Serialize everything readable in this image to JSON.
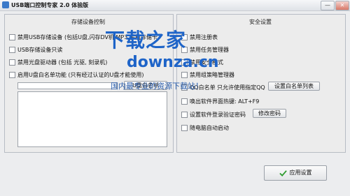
{
  "window": {
    "title": "USB端口控制专家 2.0 体验版"
  },
  "storage_panel": {
    "title": "存储设备控制",
    "options": [
      {
        "label": "禁用USB存储设备 (包括U盘,闪存DV机,MP3,手机存储卡"
      },
      {
        "label": "USB存储设备只读"
      },
      {
        "label": "禁用光盘驱动器 (包括 光驱, 刻录机)"
      },
      {
        "label": "启用U盘白名单功能 (只有经过认证的U盘才能使用)"
      }
    ],
    "whitelist_button": "U盘白名单"
  },
  "security_panel": {
    "title": "安全设置",
    "options": [
      {
        "label": "禁用注册表"
      },
      {
        "label": "禁用任务管理器"
      },
      {
        "label": "禁用安全模式"
      },
      {
        "label": "禁用组策略管理器"
      },
      {
        "label": "QQ白名单 只允许使用指定QQ"
      },
      {
        "label": "唤出软件界面热键: ALT+F9"
      },
      {
        "label": "设置软件登录验证密码"
      },
      {
        "label": "随电脑自动启动"
      }
    ],
    "qq_whitelist_button": "设置白名单列表",
    "change_password_button": "修改密码"
  },
  "apply_button": "应用设置",
  "watermark": {
    "line1": "下载之家",
    "line2": "downza.cn",
    "line3": "国内最专业的资源下载站！"
  },
  "colors": {
    "watermark_blue": "#1E64C8",
    "accent_green": "#2E9B2E"
  },
  "icons": {
    "app": "app-icon",
    "apply": "checkmark-icon"
  },
  "window_buttons": {
    "minimize": "—",
    "close": "✕"
  }
}
